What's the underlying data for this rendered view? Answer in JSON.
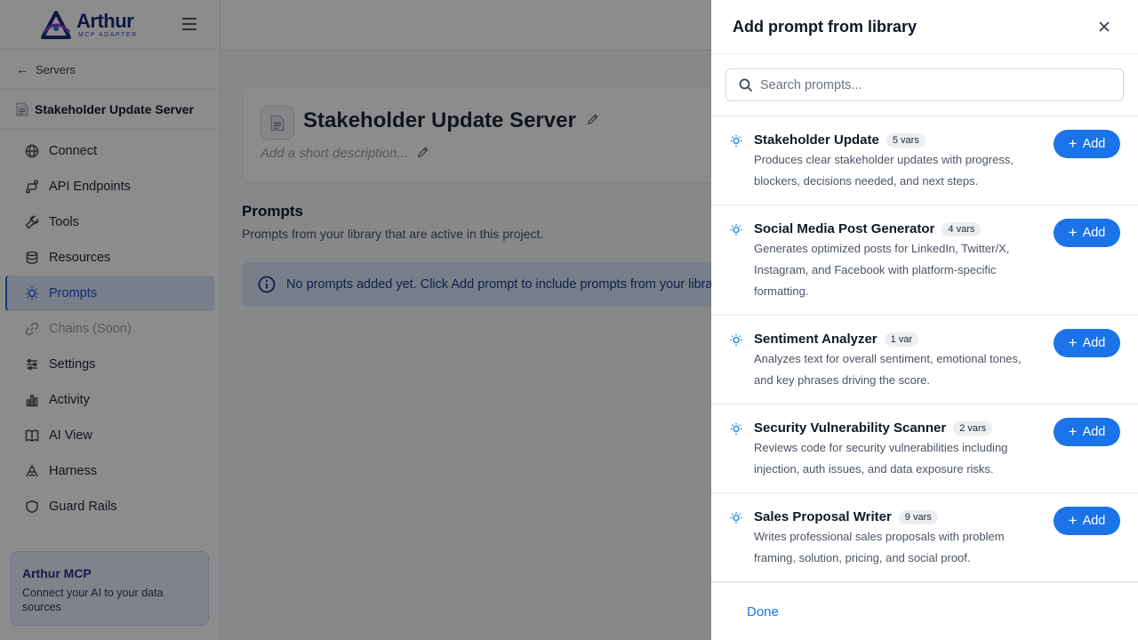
{
  "brand": {
    "name": "Arthur",
    "subtitle": "MCP ADAPTER",
    "colors": {
      "primary": "#1a73e8",
      "navy": "#1e2a78",
      "active_bg": "#dbe7fb"
    }
  },
  "sidebar": {
    "back_label": "Servers",
    "server_name": "Stakeholder Update Server",
    "items": [
      {
        "label": "Connect",
        "icon": "globe-icon"
      },
      {
        "label": "API Endpoints",
        "icon": "route-icon"
      },
      {
        "label": "Tools",
        "icon": "wrench-icon"
      },
      {
        "label": "Resources",
        "icon": "database-icon"
      },
      {
        "label": "Prompts",
        "icon": "lightbulb-icon",
        "active": true
      },
      {
        "label": "Chains (Soon)",
        "icon": "link-icon",
        "disabled": true
      },
      {
        "label": "Settings",
        "icon": "sliders-icon"
      },
      {
        "label": "Activity",
        "icon": "bar-chart-icon"
      },
      {
        "label": "AI View",
        "icon": "book-icon"
      },
      {
        "label": "Harness",
        "icon": "harness-icon"
      },
      {
        "label": "Guard Rails",
        "icon": "shield-icon"
      }
    ],
    "promo": {
      "title": "Arthur MCP",
      "text": "Connect your AI to your data sources"
    }
  },
  "main": {
    "server_title": "Stakeholder Update Server",
    "description_placeholder": "Add a short description...",
    "section_title": "Prompts",
    "section_subtitle": "Prompts from your library that are active in this project.",
    "empty_message": "No prompts added yet. Click Add prompt to include prompts from your library."
  },
  "drawer": {
    "title": "Add prompt from library",
    "search_placeholder": "Search prompts...",
    "add_label": "Add",
    "done_label": "Done",
    "prompts": [
      {
        "name": "Stakeholder Update",
        "vars": "5 vars",
        "description": "Produces clear stakeholder updates with progress, blockers, decisions needed, and next steps."
      },
      {
        "name": "Social Media Post Generator",
        "vars": "4 vars",
        "description": "Generates optimized posts for LinkedIn, Twitter/X, Instagram, and Facebook with platform-specific formatting."
      },
      {
        "name": "Sentiment Analyzer",
        "vars": "1 var",
        "description": "Analyzes text for overall sentiment, emotional tones, and key phrases driving the score."
      },
      {
        "name": "Security Vulnerability Scanner",
        "vars": "2 vars",
        "description": "Reviews code for security vulnerabilities including injection, auth issues, and data exposure risks."
      },
      {
        "name": "Sales Proposal Writer",
        "vars": "9 vars",
        "description": "Writes professional sales proposals with problem framing, solution, pricing, and social proof."
      }
    ]
  }
}
